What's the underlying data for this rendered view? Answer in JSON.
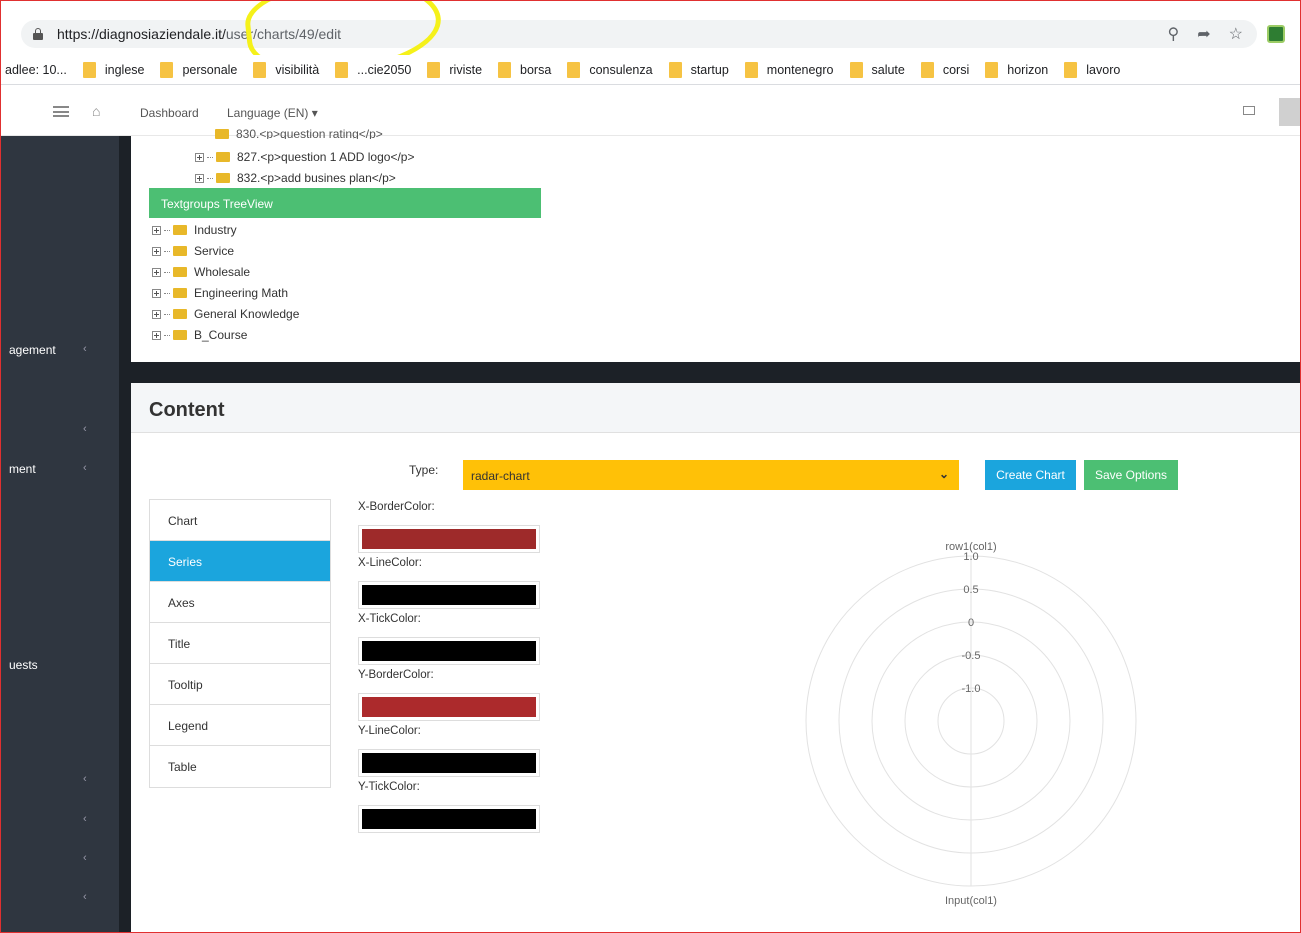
{
  "browser": {
    "url_domain": "https://diagnosiaziendale.it/",
    "url_path": "user/charts/49/edit",
    "bookmarks": [
      "adlee: 10...",
      "inglese",
      "personale",
      "visibilità",
      "...cie2050",
      "riviste",
      "borsa",
      "consulenza",
      "startup",
      "montenegro",
      "salute",
      "corsi",
      "horizon",
      "lavoro"
    ]
  },
  "header": {
    "dashboard": "Dashboard",
    "language": "Language (EN)"
  },
  "sidebar": {
    "items": [
      "agement",
      "ment",
      "uests"
    ]
  },
  "tree": {
    "partial_top": "830.<p>question rating</p>",
    "items": [
      "827.<p>question 1 ADD logo</p>",
      "832.<p>add busines plan</p>"
    ],
    "textgroups_header": "Textgroups TreeView",
    "textgroups": [
      "Industry",
      "Service",
      "Wholesale",
      "Engineering Math",
      "General Knowledge",
      "B_Course"
    ]
  },
  "content": {
    "title": "Content",
    "type_label": "Type:",
    "type_value": "radar-chart",
    "create_button": "Create Chart",
    "save_button": "Save Options",
    "tabs": [
      "Chart",
      "Series",
      "Axes",
      "Title",
      "Tooltip",
      "Legend",
      "Table"
    ],
    "active_tab": "Series",
    "colors": [
      {
        "label": "X-BorderColor:",
        "value": "#9e2a2a"
      },
      {
        "label": "X-LineColor:",
        "value": "#000000"
      },
      {
        "label": "X-TickColor:",
        "value": "#000000"
      },
      {
        "label": "Y-BorderColor:",
        "value": "#ac2a2c"
      },
      {
        "label": "Y-LineColor:",
        "value": "#000000"
      },
      {
        "label": "Y-TickColor:",
        "value": "#000000"
      }
    ]
  },
  "chart_data": {
    "type": "radar",
    "axes": [
      "row1(col1)",
      "Input(col1)"
    ],
    "ticks": [
      "1.0",
      "0.5",
      "0",
      "-0.5",
      "-1.0"
    ],
    "ylim": [
      -1.0,
      1.0
    ],
    "grid": true
  }
}
